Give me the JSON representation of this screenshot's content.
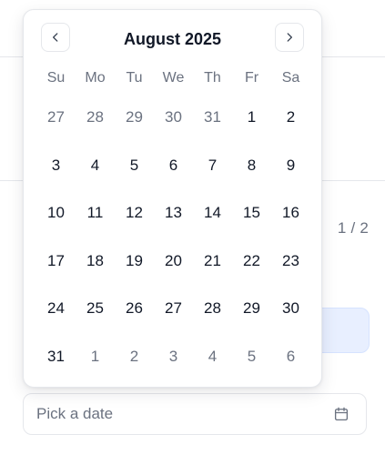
{
  "background": {
    "pager_text": "1 / 2",
    "date_input": {
      "placeholder": "Pick a date",
      "icon": "calendar-icon"
    }
  },
  "calendar": {
    "title": "August 2025",
    "prev_icon": "chevron-left-icon",
    "next_icon": "chevron-right-icon",
    "weekdays": [
      "Su",
      "Mo",
      "Tu",
      "We",
      "Th",
      "Fr",
      "Sa"
    ],
    "weeks": [
      [
        {
          "label": "27",
          "outside": true
        },
        {
          "label": "28",
          "outside": true
        },
        {
          "label": "29",
          "outside": true
        },
        {
          "label": "30",
          "outside": true
        },
        {
          "label": "31",
          "outside": true
        },
        {
          "label": "1",
          "outside": false
        },
        {
          "label": "2",
          "outside": false
        }
      ],
      [
        {
          "label": "3",
          "outside": false
        },
        {
          "label": "4",
          "outside": false
        },
        {
          "label": "5",
          "outside": false
        },
        {
          "label": "6",
          "outside": false
        },
        {
          "label": "7",
          "outside": false
        },
        {
          "label": "8",
          "outside": false
        },
        {
          "label": "9",
          "outside": false
        }
      ],
      [
        {
          "label": "10",
          "outside": false
        },
        {
          "label": "11",
          "outside": false
        },
        {
          "label": "12",
          "outside": false
        },
        {
          "label": "13",
          "outside": false
        },
        {
          "label": "14",
          "outside": false
        },
        {
          "label": "15",
          "outside": false
        },
        {
          "label": "16",
          "outside": false
        }
      ],
      [
        {
          "label": "17",
          "outside": false
        },
        {
          "label": "18",
          "outside": false
        },
        {
          "label": "19",
          "outside": false
        },
        {
          "label": "20",
          "outside": false
        },
        {
          "label": "21",
          "outside": false
        },
        {
          "label": "22",
          "outside": false
        },
        {
          "label": "23",
          "outside": false
        }
      ],
      [
        {
          "label": "24",
          "outside": false
        },
        {
          "label": "25",
          "outside": false
        },
        {
          "label": "26",
          "outside": false
        },
        {
          "label": "27",
          "outside": false
        },
        {
          "label": "28",
          "outside": false
        },
        {
          "label": "29",
          "outside": false
        },
        {
          "label": "30",
          "outside": false
        }
      ],
      [
        {
          "label": "31",
          "outside": false
        },
        {
          "label": "1",
          "outside": true
        },
        {
          "label": "2",
          "outside": true
        },
        {
          "label": "3",
          "outside": true
        },
        {
          "label": "4",
          "outside": true
        },
        {
          "label": "5",
          "outside": true
        },
        {
          "label": "6",
          "outside": true
        }
      ]
    ]
  },
  "colors": {
    "text_primary": "#111827",
    "text_muted": "#6b7280",
    "border": "#e5e7eb",
    "highlight": "#e8efff"
  }
}
